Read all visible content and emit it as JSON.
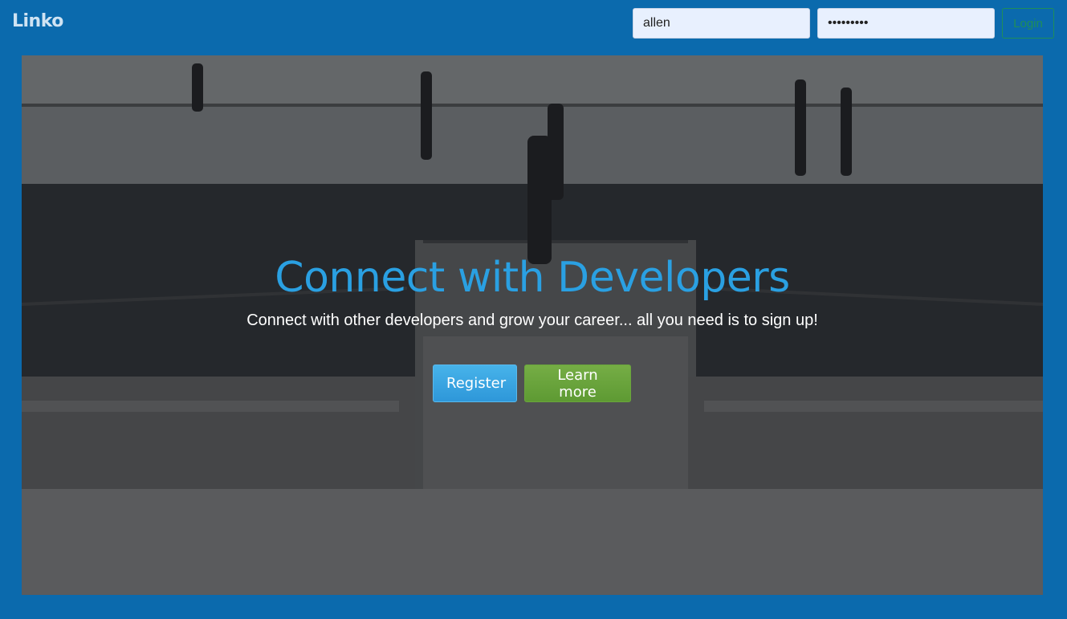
{
  "navbar": {
    "brand": "Linko",
    "username_value": "allen",
    "password_value": "allen1234",
    "login_label": "Login"
  },
  "hero": {
    "title": "Connect with Developers",
    "subtitle": "Connect with other developers and grow your career... all you need is to sign up!",
    "register_label": "Register",
    "learn_more_label": "Learn more"
  },
  "colors": {
    "page_background": "#0b6aad",
    "title_blue": "#2aa0e2",
    "register_button": "#3aa5e2",
    "learn_more_button": "#6aa53c",
    "login_outline": "#1f8e5a"
  }
}
